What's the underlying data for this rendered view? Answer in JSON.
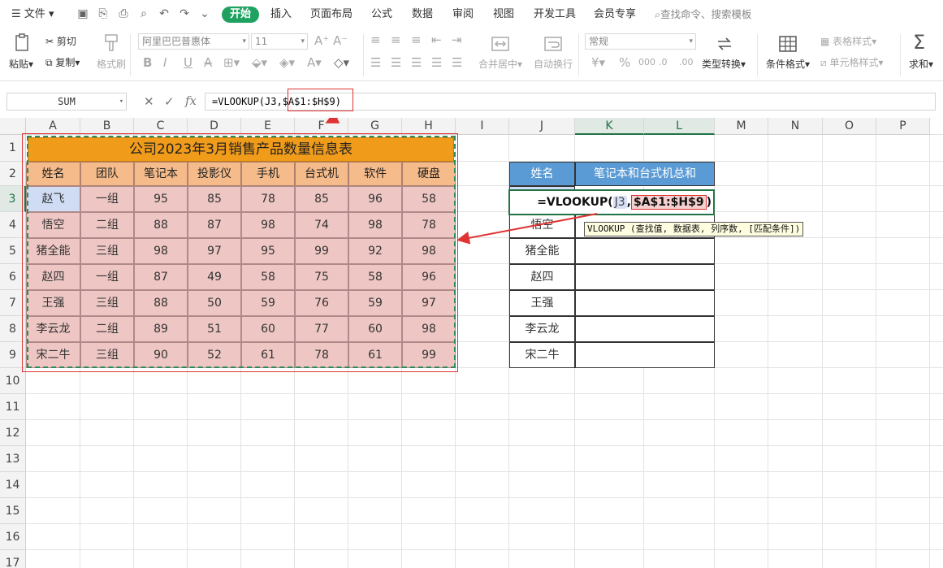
{
  "menu": {
    "file": "文件",
    "tabs": [
      "开始",
      "插入",
      "页面布局",
      "公式",
      "数据",
      "审阅",
      "视图",
      "开发工具",
      "会员专享"
    ],
    "search": "查找命令、搜索模板"
  },
  "ribbon": {
    "paste": "粘贴",
    "cut": "剪切",
    "copy": "复制",
    "format_painter": "格式刷",
    "font_name": "阿里巴巴普惠体",
    "font_size": "11",
    "merge_center": "合并居中",
    "wrap_text": "自动换行",
    "number_format": "常规",
    "type_convert": "类型转换",
    "conditional_format": "条件格式",
    "table_style": "表格样式",
    "cell_style": "单元格样式",
    "sum": "求和"
  },
  "formula_bar": {
    "name_box": "SUM",
    "formula": "=VLOOKUP(J3,$A$1:$H$9)"
  },
  "columns": [
    "A",
    "B",
    "C",
    "D",
    "E",
    "F",
    "G",
    "H",
    "I",
    "J",
    "K",
    "L",
    "M",
    "N",
    "O",
    "P"
  ],
  "rows": [
    "1",
    "2",
    "3",
    "4",
    "5",
    "6",
    "7",
    "8",
    "9",
    "10",
    "11",
    "12",
    "13",
    "14",
    "15",
    "16",
    "17"
  ],
  "table1": {
    "title": "公司2023年3月销售产品数量信息表",
    "headers": [
      "姓名",
      "团队",
      "笔记本",
      "投影仪",
      "手机",
      "台式机",
      "软件",
      "硬盘"
    ],
    "rows": [
      [
        "赵飞",
        "一组",
        "95",
        "85",
        "78",
        "85",
        "96",
        "58"
      ],
      [
        "悟空",
        "二组",
        "88",
        "87",
        "98",
        "74",
        "98",
        "78"
      ],
      [
        "猪全能",
        "三组",
        "98",
        "97",
        "95",
        "99",
        "92",
        "98"
      ],
      [
        "赵四",
        "一组",
        "87",
        "49",
        "58",
        "75",
        "58",
        "96"
      ],
      [
        "王强",
        "三组",
        "88",
        "50",
        "59",
        "76",
        "59",
        "97"
      ],
      [
        "李云龙",
        "二组",
        "89",
        "51",
        "60",
        "77",
        "60",
        "98"
      ],
      [
        "宋二牛",
        "三组",
        "90",
        "52",
        "61",
        "78",
        "61",
        "99"
      ]
    ]
  },
  "table2": {
    "headers": [
      "姓名",
      "笔记本和台式机总和"
    ],
    "names": [
      "",
      "悟空",
      "猪全能",
      "赵四",
      "王强",
      "李云龙",
      "宋二牛"
    ]
  },
  "editing": {
    "prefix": "=VLOOKUP(",
    "ref1": "J3",
    "sep": ",",
    "ref2": "$A$1:$H$9",
    "suffix": ")",
    "tooltip": "VLOOKUP (查找值, 数据表, 列序数, [匹配条件])"
  },
  "colors": {
    "active_tab": "#1fa260",
    "title_fill": "#f09b1a",
    "header_fill": "#f6bb8a",
    "body_fill": "#eec7c4",
    "table2_header": "#5b9bd5",
    "annotation_red": "#e03333"
  }
}
